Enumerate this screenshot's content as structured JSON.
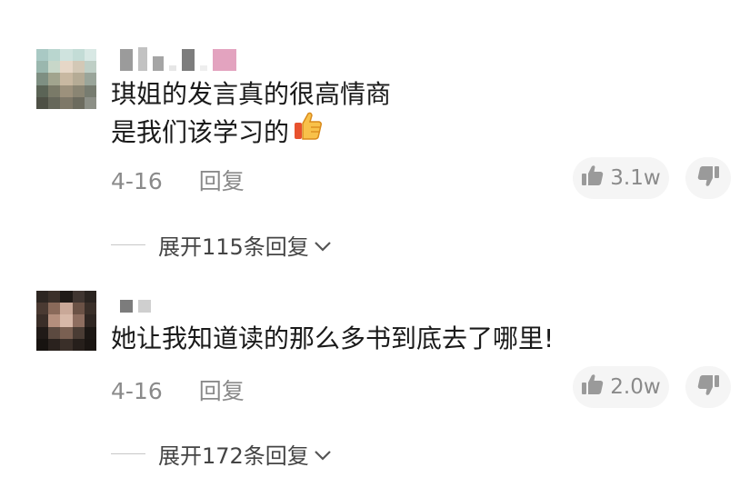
{
  "comments": [
    {
      "text_lines": [
        "琪姐的发言真的很高情商",
        "是我们该学习的"
      ],
      "emoji": "thumbs-up-emoji",
      "date": "4-16",
      "reply_label": "回复",
      "likes": "3.1w",
      "expand_label": "展开115条回复"
    },
    {
      "text_lines": [
        "她让我知道读的那么多书到底去了哪里!"
      ],
      "date": "4-16",
      "reply_label": "回复",
      "likes": "2.0w",
      "expand_label": "展开172条回复"
    }
  ],
  "icons": {
    "like": "thumbs-up-icon",
    "dislike": "thumbs-down-icon",
    "expand": "chevron-down-icon"
  },
  "colors": {
    "text": "#1a1a1a",
    "meta": "#8a8a8a",
    "pill_bg": "#f5f5f5"
  }
}
